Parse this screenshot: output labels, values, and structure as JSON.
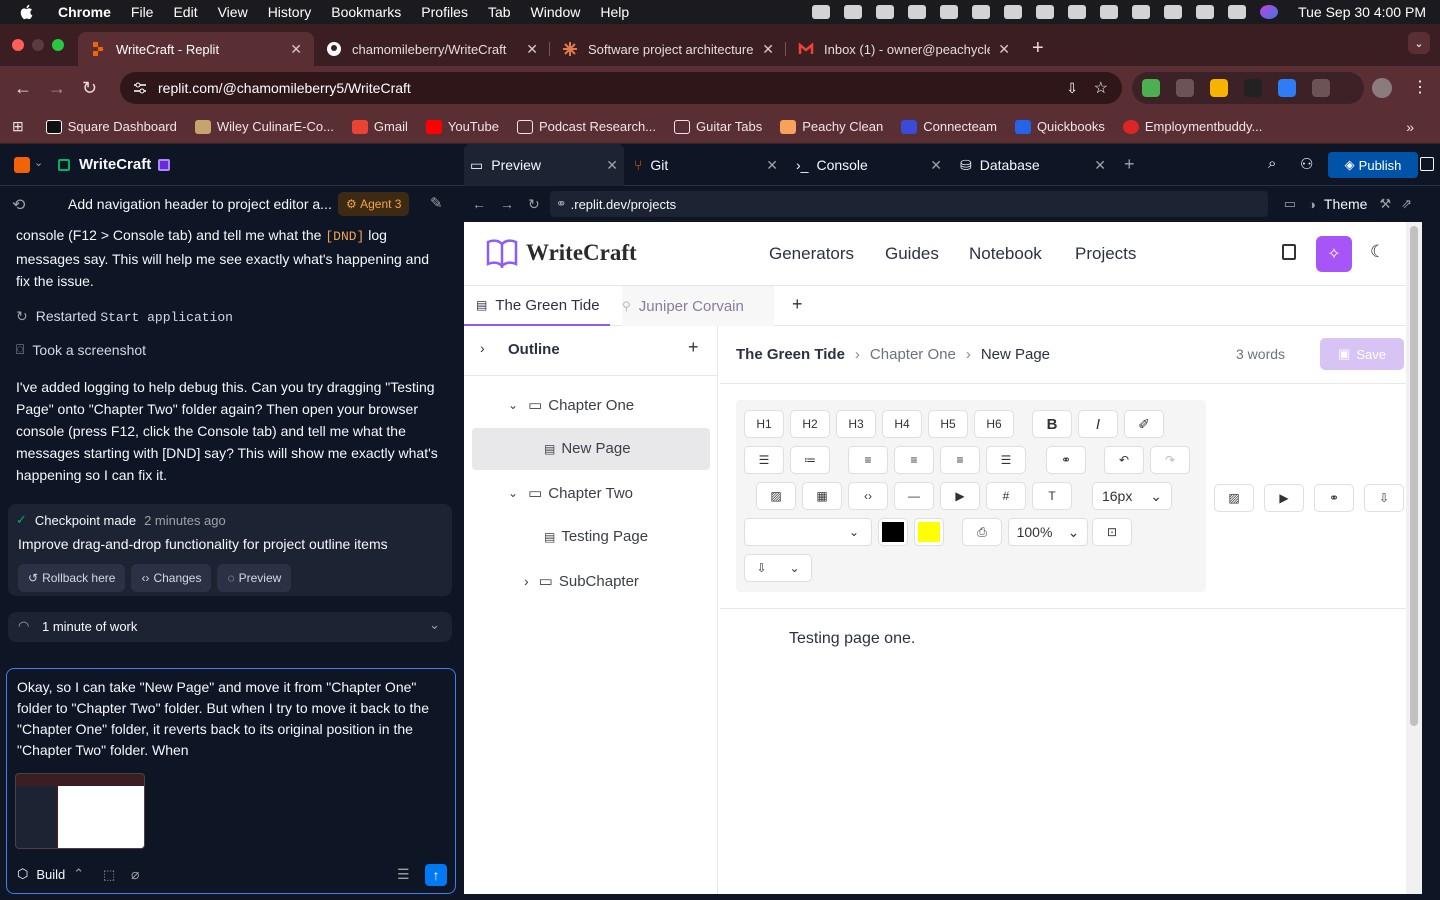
{
  "menubar": {
    "app": "Chrome",
    "items": [
      "File",
      "Edit",
      "View",
      "History",
      "Bookmarks",
      "Profiles",
      "Tab",
      "Window",
      "Help"
    ],
    "clock": "Tue Sep 30  4:00 PM"
  },
  "browser": {
    "tabs": [
      {
        "title": "WriteCraft - Replit"
      },
      {
        "title": "chamomileberry/WriteCraft"
      },
      {
        "title": "Software project architecture"
      },
      {
        "title": "Inbox (1) - owner@peachycle"
      }
    ],
    "url": "replit.com/@chamomileberry5/WriteCraft",
    "bookmarks": [
      "Square Dashboard",
      "Wiley CulinarE-Co...",
      "Gmail",
      "YouTube",
      "Podcast Research...",
      "Guitar Tabs",
      "Peachy Clean",
      "Connecteam",
      "Quickbooks",
      "Employmentbuddy..."
    ]
  },
  "replit": {
    "project": "WriteCraft",
    "panel_tabs": [
      "Preview",
      "Git",
      "Console",
      "Database"
    ],
    "publish": "Publish",
    "theme": "Theme",
    "preview_url": ".replit.dev/projects"
  },
  "chat": {
    "thread_title": "Add navigation header to project editor a...",
    "agent_badge": "Agent 3",
    "msg1_a": "console (F12 > Console tab) and tell me what the ",
    "msg1_dnd": "[DND]",
    "msg1_b": " log messages say. This will help me see exactly what's happening and fix the issue.",
    "action1_label": "Restarted ",
    "action1_code": "Start application",
    "action2": "Took a screenshot",
    "msg2": "I've added logging to help debug this. Can you try dragging \"Testing Page\" onto \"Chapter Two\" folder again? Then open your browser console (press F12, click the Console tab) and tell me what the messages starting with [DND] say? This will show me exactly what's happening so I can fix it.",
    "checkpoint_label": "Checkpoint made",
    "checkpoint_time": "2 minutes ago",
    "checkpoint_title": "Improve drag-and-drop functionality for project outline items",
    "chips": [
      "Rollback here",
      "Changes",
      "Preview"
    ],
    "work": "1 minute of work",
    "input_text": "Okay, so I can take \"New Page\" and move it from \"Chapter One\" folder to \"Chapter Two\" folder. But when I try to move it back to the \"Chapter One\" folder, it reverts back to its original position in the \"Chapter Two\" folder. When",
    "mode": "Build"
  },
  "app": {
    "brand": "WriteCraft",
    "nav": [
      "Generators",
      "Guides",
      "Notebook",
      "Projects"
    ],
    "doc_tabs": [
      "The Green Tide",
      "Juniper Corvain"
    ],
    "outline_label": "Outline",
    "outline": {
      "ch1": "Chapter One",
      "page1": "New Page",
      "ch2": "Chapter Two",
      "page2": "Testing Page",
      "sub": "SubChapter"
    },
    "breadcrumb": [
      "The Green Tide",
      "Chapter One",
      "New Page"
    ],
    "word_count": "3 words",
    "save": "Save",
    "headings": [
      "H1",
      "H2",
      "H3",
      "H4",
      "H5",
      "H6"
    ],
    "font_size": "16px",
    "zoom": "100%",
    "text_color": "#000000",
    "highlight_color": "#ffff00",
    "body_text": "Testing page one."
  },
  "colors": {
    "accent": "#3c7ff0",
    "purple": "#a855f7",
    "browser_tab": "#5a2f33"
  }
}
